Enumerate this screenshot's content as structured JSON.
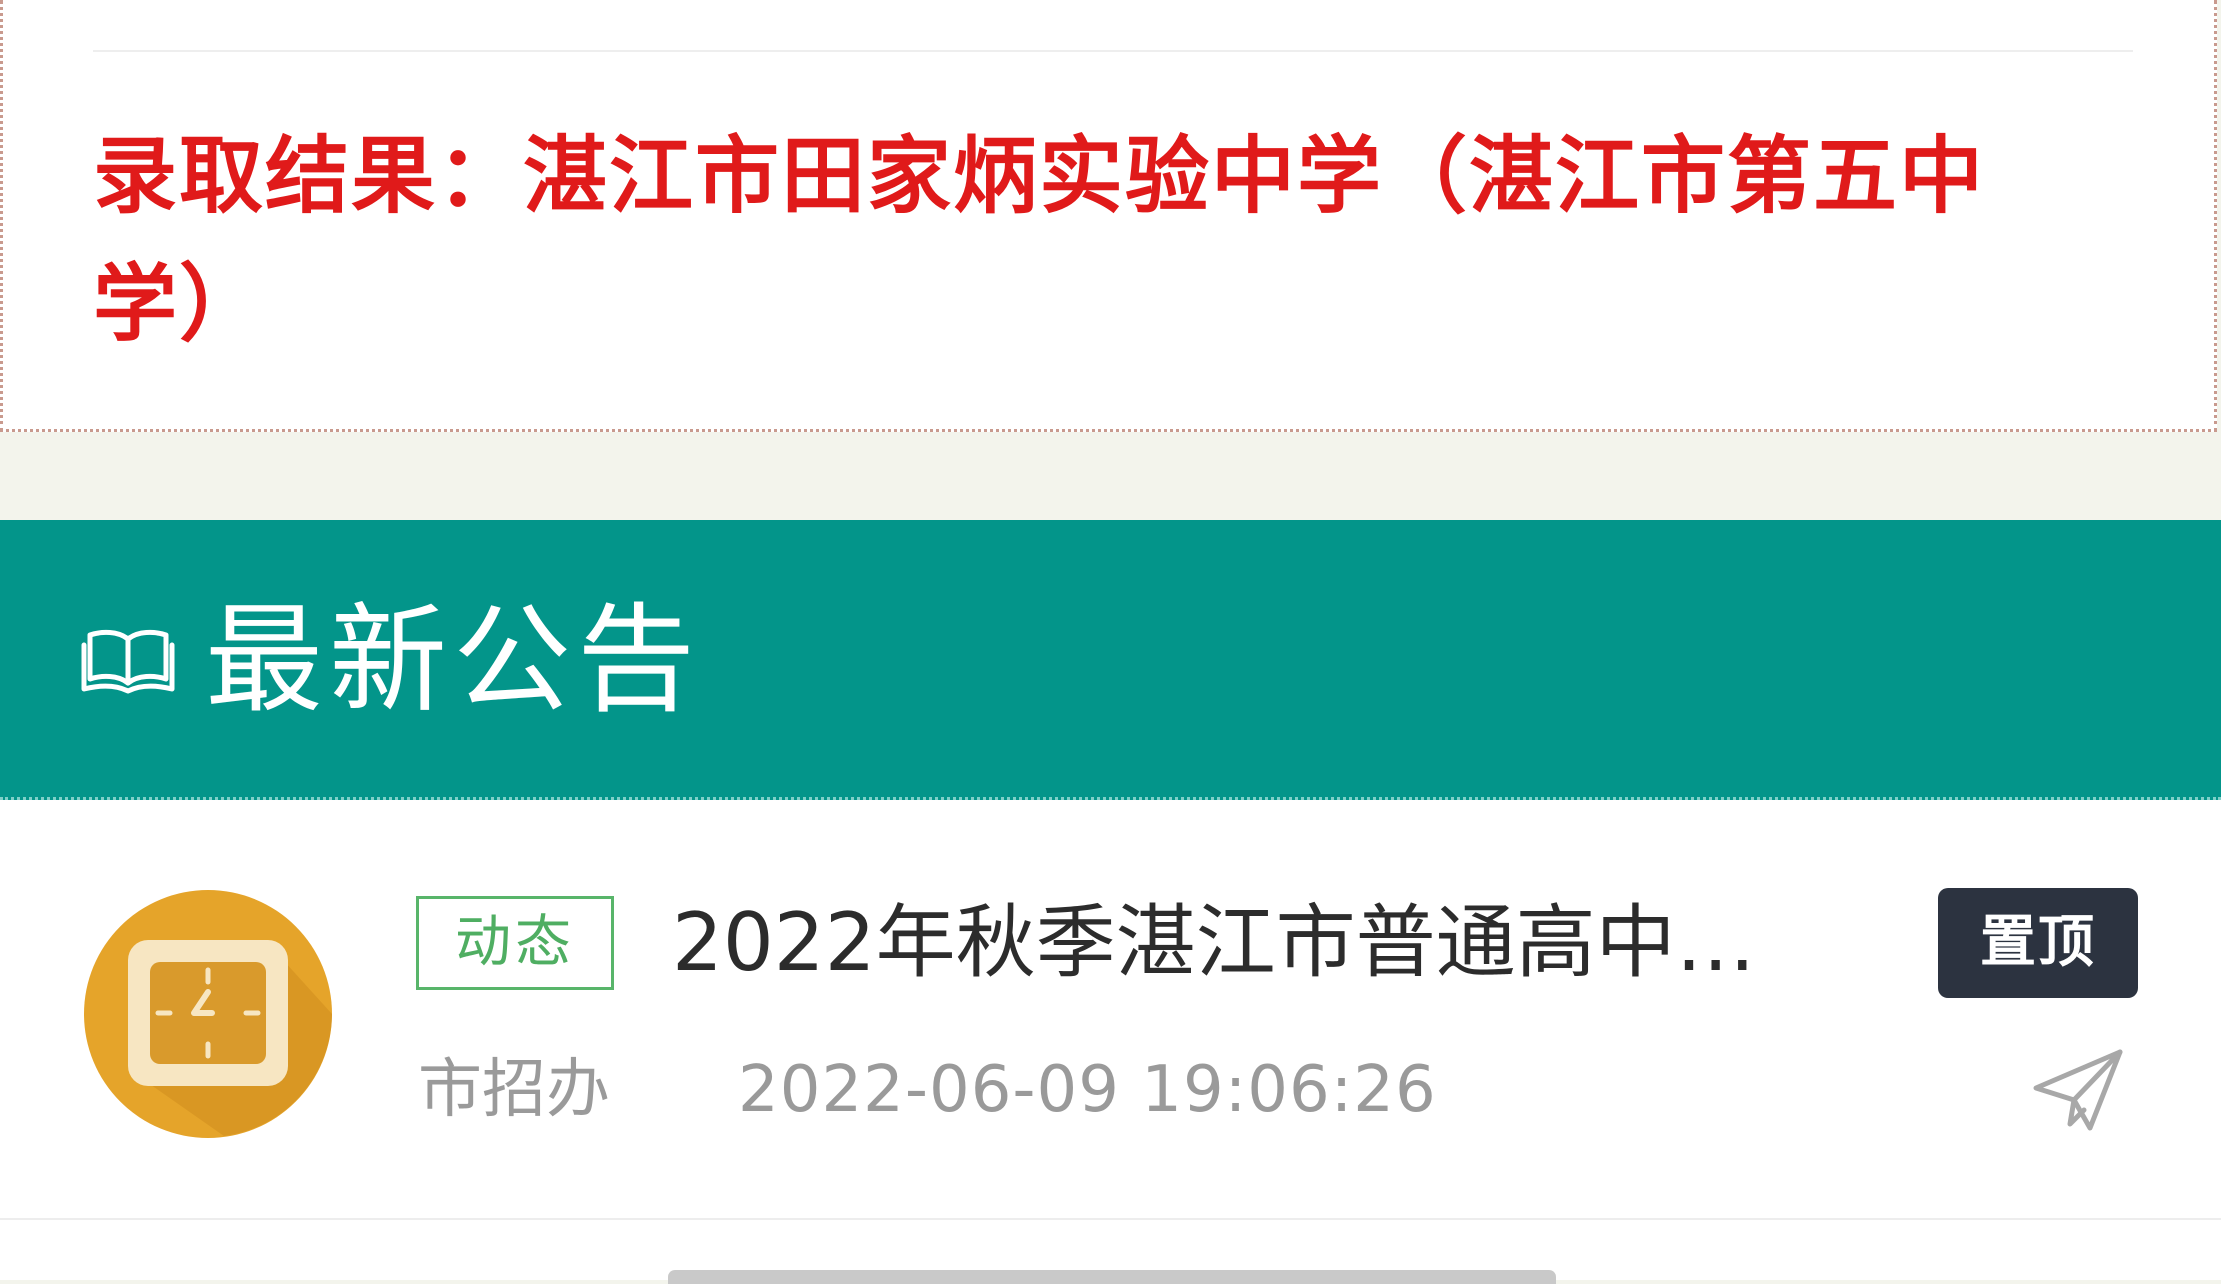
{
  "result": {
    "label": "录取结果：",
    "value": "湛江市田家炳实验中学（湛江市第五中学）"
  },
  "notices": {
    "header_title": "最新公告",
    "items": [
      {
        "tag": "动态",
        "title": "2022年秋季湛江市普通高中…",
        "pinned_label": "置顶",
        "publisher": "市招办",
        "timestamp": "2022-06-09 19:06:26"
      }
    ]
  },
  "icons": {
    "header": "book-open-icon",
    "avatar": "clock-icon",
    "share": "paper-plane-icon"
  },
  "colors": {
    "result_red": "#e01a1a",
    "header_teal": "#03958a",
    "tag_green": "#4fae62",
    "pin_dark": "#2c3340",
    "avatar_orange": "#e5a42a"
  }
}
